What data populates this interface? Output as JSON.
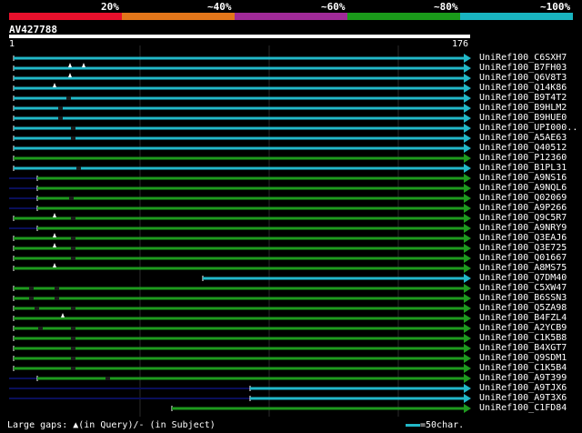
{
  "colors": {
    "background": "#000000",
    "scale": [
      "#e8102c",
      "#e3761a",
      "#a02a98",
      "#1a9a1a",
      "#19b4c0"
    ],
    "cyan": "#22b8c8",
    "green": "#1e9a1e",
    "navy": "#0a0f5a",
    "ruler": "#ffffff",
    "text": "#ffffff"
  },
  "scale": {
    "labels": [
      "20%",
      "~40%",
      "~60%",
      "~80%",
      "~100%"
    ]
  },
  "query": {
    "name": "AV427788",
    "ruler_start": "1",
    "ruler_end": "176"
  },
  "hits": [
    {
      "label": "UniRef100_C6SXH7",
      "color": "cyan"
    },
    {
      "label": "UniRef100_B7FH03",
      "color": "cyan"
    },
    {
      "label": "UniRef100_Q6V8T3",
      "color": "cyan"
    },
    {
      "label": "UniRef100_Q14K86",
      "color": "cyan"
    },
    {
      "label": "UniRef100_B9T4T2",
      "color": "cyan"
    },
    {
      "label": "UniRef100_B9HLM2",
      "color": "cyan"
    },
    {
      "label": "UniRef100_B9HUE0",
      "color": "cyan"
    },
    {
      "label": "UniRef100_UPI000..",
      "color": "cyan"
    },
    {
      "label": "UniRef100_A5AE63",
      "color": "cyan"
    },
    {
      "label": "UniRef100_Q40512",
      "color": "cyan"
    },
    {
      "label": "UniRef100_P12360",
      "color": "green"
    },
    {
      "label": "UniRef100_B1PL31",
      "color": "cyan"
    },
    {
      "label": "UniRef100_A9NS16",
      "color": "green"
    },
    {
      "label": "UniRef100_A9NQL6",
      "color": "green"
    },
    {
      "label": "UniRef100_Q02069",
      "color": "green"
    },
    {
      "label": "UniRef100_A9P266",
      "color": "green"
    },
    {
      "label": "UniRef100_Q9C5R7",
      "color": "green"
    },
    {
      "label": "UniRef100_A9NRY9",
      "color": "green"
    },
    {
      "label": "UniRef100_Q3EAJ6",
      "color": "green"
    },
    {
      "label": "UniRef100_Q3E725",
      "color": "green"
    },
    {
      "label": "UniRef100_Q01667",
      "color": "green"
    },
    {
      "label": "UniRef100_A8MS75",
      "color": "green"
    },
    {
      "label": "UniRef100_Q7DM40",
      "color": "cyan"
    },
    {
      "label": "UniRef100_C5XW47",
      "color": "green"
    },
    {
      "label": "UniRef100_B6SSN3",
      "color": "green"
    },
    {
      "label": "UniRef100_Q5ZA98",
      "color": "green"
    },
    {
      "label": "UniRef100_B4FZL4",
      "color": "green"
    },
    {
      "label": "UniRef100_A2YCB9",
      "color": "green"
    },
    {
      "label": "UniRef100_C1K5B8",
      "color": "green"
    },
    {
      "label": "UniRef100_B4XGT7",
      "color": "green"
    },
    {
      "label": "UniRef100_Q9SDM1",
      "color": "green"
    },
    {
      "label": "UniRef100_C1K5B4",
      "color": "green"
    },
    {
      "label": "UniRef100_A9T399",
      "color": "green"
    },
    {
      "label": "UniRef100_A9TJX6",
      "color": "cyan"
    },
    {
      "label": "UniRef100_A9T3X6",
      "color": "cyan"
    },
    {
      "label": "UniRef100_C1FD84",
      "color": "green"
    }
  ],
  "footer": {
    "legend_text": "Large gaps: ▲(in Query)/- (in Subject)",
    "scale_text": "=50char."
  }
}
